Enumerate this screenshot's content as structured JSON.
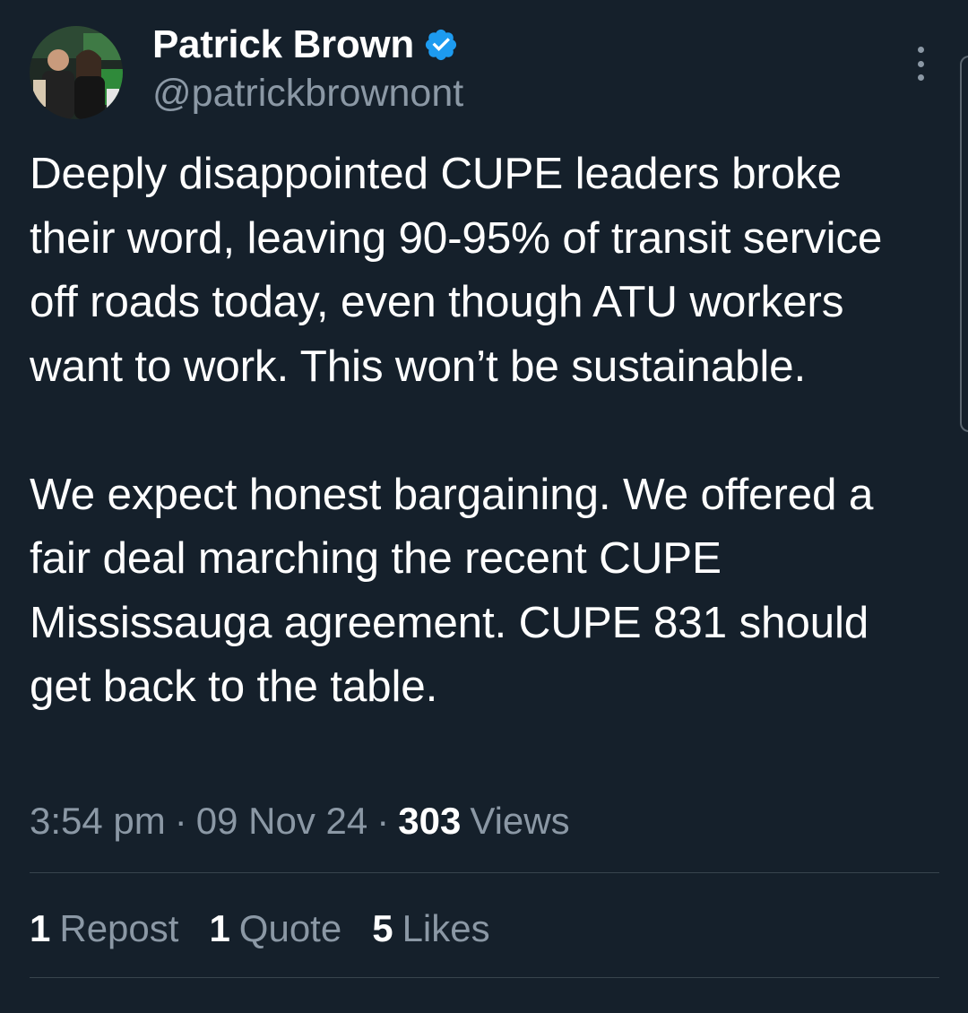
{
  "author": {
    "display_name": "Patrick Brown",
    "handle": "@patrickbrownont",
    "verified": true,
    "verified_icon": "verified-badge-icon",
    "accent_color": "#1d9bf0"
  },
  "tweet": {
    "paragraphs": [
      "Deeply disappointed CUPE leaders broke their word, leaving 90-95% of transit service off roads today, even though ATU workers want to work. This won’t be sustainable.",
      "We expect honest bargaining. We offered a fair deal marching the recent CUPE Mississauga agreement. CUPE 831 should get back to the table."
    ],
    "time": "3:54 pm",
    "separator": "·",
    "date": "09 Nov 24",
    "views_count": "303",
    "views_label": "Views"
  },
  "stats": {
    "reposts_count": "1",
    "reposts_label": "Repost",
    "quotes_count": "1",
    "quotes_label": "Quote",
    "likes_count": "5",
    "likes_label": "Likes"
  },
  "colors": {
    "background": "#15202b",
    "primary_text": "#ffffff",
    "secondary_text": "#8b98a5",
    "divider": "#38444d"
  }
}
